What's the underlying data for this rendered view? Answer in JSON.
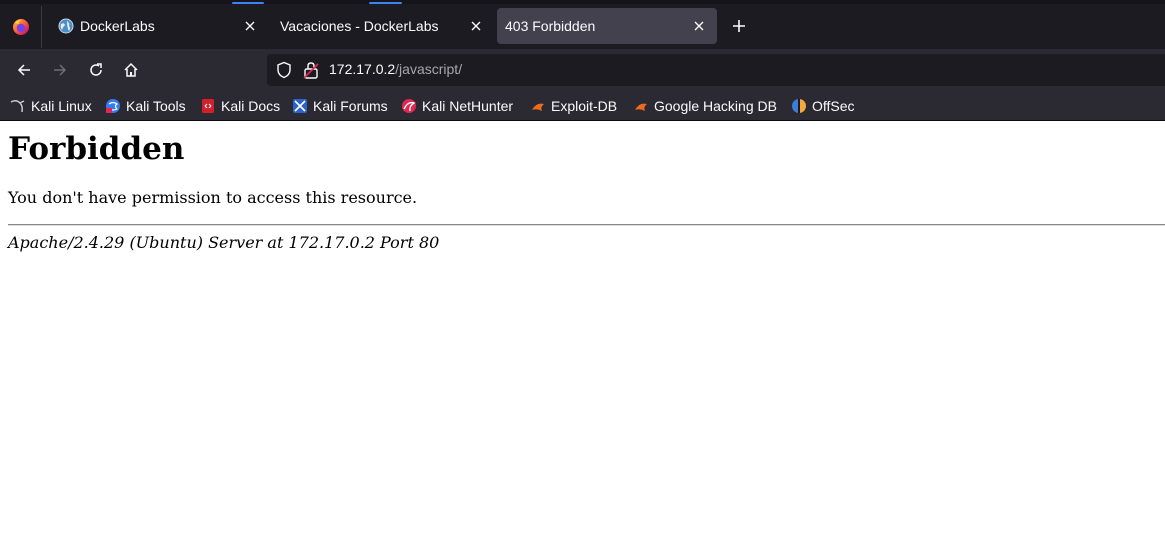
{
  "tabs": [
    {
      "title": "DockerLabs",
      "favicon": "globe-icon"
    },
    {
      "title": "Vacaciones - DockerLabs",
      "favicon": "none"
    },
    {
      "title": "403 Forbidden",
      "favicon": "none",
      "active": true
    }
  ],
  "navbar": {
    "url_host": "172.17.0.2",
    "url_path": "/javascript/"
  },
  "bookmarks": [
    {
      "label": "Kali Linux",
      "icon": "kali-dragon-icon"
    },
    {
      "label": "Kali Tools",
      "icon": "kali-tools-icon"
    },
    {
      "label": "Kali Docs",
      "icon": "kali-docs-icon"
    },
    {
      "label": "Kali Forums",
      "icon": "kali-forums-icon"
    },
    {
      "label": "Kali NetHunter",
      "icon": "nethunter-icon"
    },
    {
      "label": "Exploit-DB",
      "icon": "exploit-db-icon"
    },
    {
      "label": "Google Hacking DB",
      "icon": "ghdb-icon"
    },
    {
      "label": "OffSec",
      "icon": "offsec-icon"
    }
  ],
  "page": {
    "heading": "Forbidden",
    "message": "You don't have permission to access this resource.",
    "server_signature": "Apache/2.4.29 (Ubuntu) Server at 172.17.0.2 Port 80"
  },
  "colors": {
    "chrome_dark": "#1c1b22",
    "toolbar": "#2b2a33",
    "active_tab": "#42414d",
    "accent": "#3b82f6"
  }
}
